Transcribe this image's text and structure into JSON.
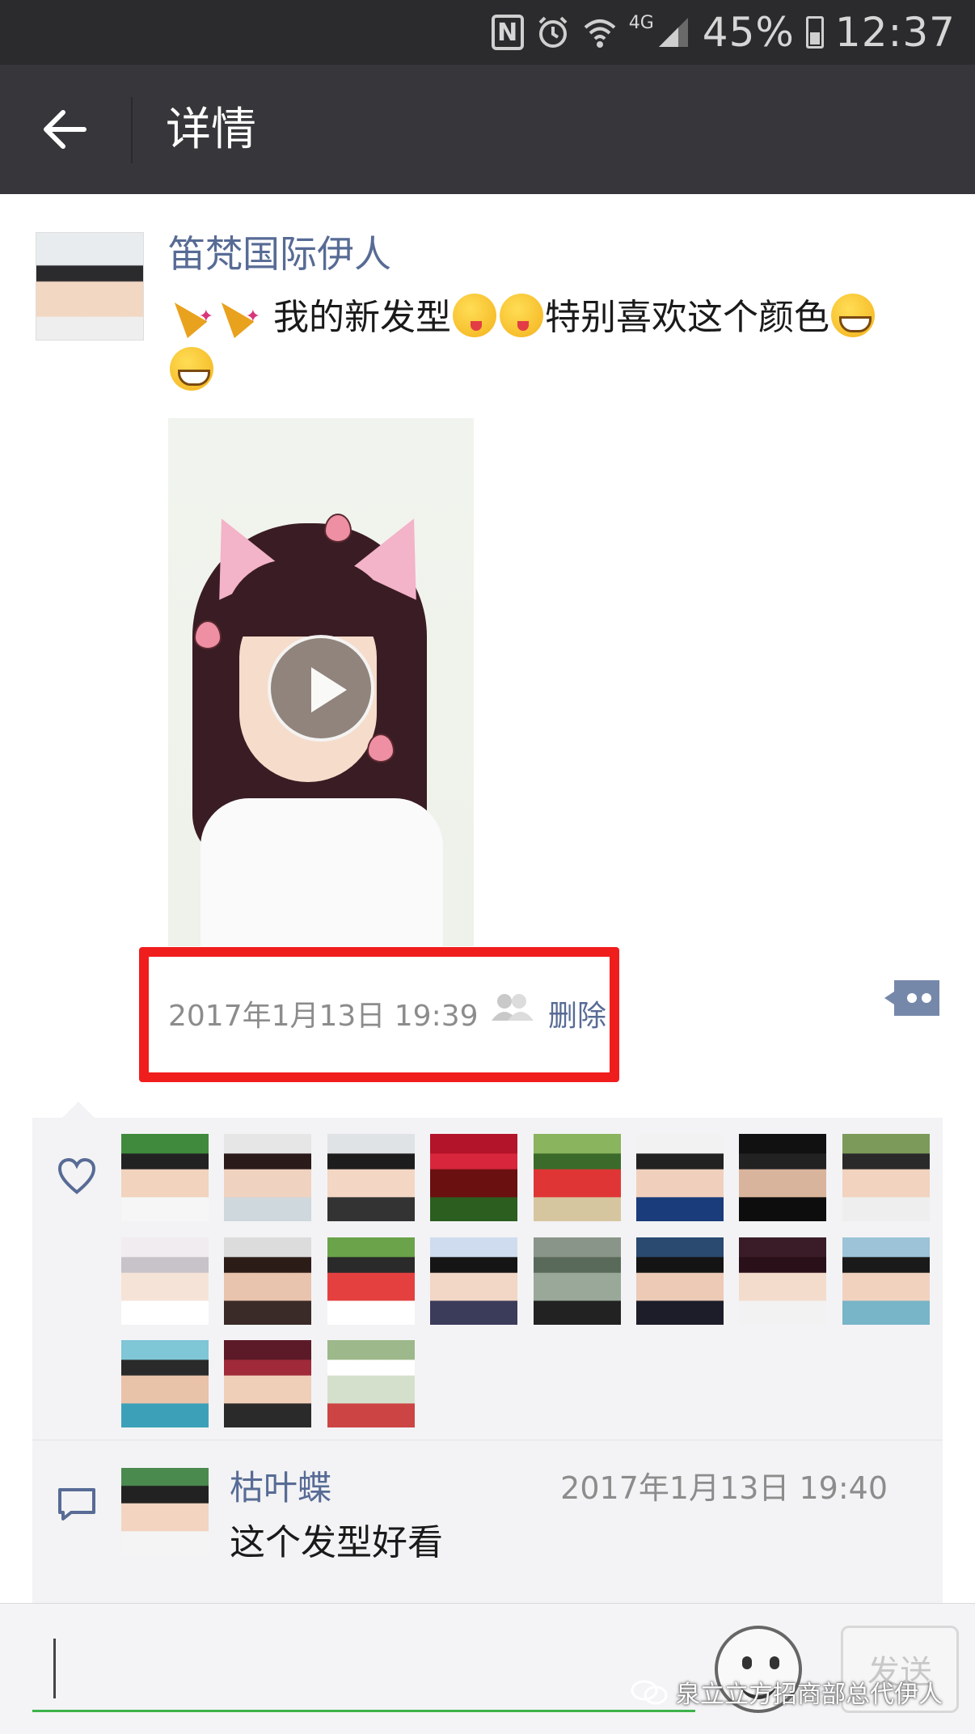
{
  "status_bar": {
    "nfc_label": "N",
    "alarm_icon": "alarm-clock-icon",
    "wifi_icon": "wifi-icon",
    "network_type": "4G",
    "battery_percent": "45%",
    "time": "12:37"
  },
  "title_bar": {
    "back_icon": "arrow-left-icon",
    "title": "详情"
  },
  "post": {
    "author": "笛梵国际伊人",
    "text_parts": [
      "我的新发型",
      "特别喜欢这个颜色"
    ],
    "emoji_icons": [
      "party-popper-icon",
      "party-popper-icon",
      "winking-tongue-face-icon",
      "winking-tongue-face-icon",
      "grinning-face-icon",
      "grinning-face-icon"
    ],
    "media_type": "video",
    "play_icon": "play-icon",
    "timestamp": "2017年1月13日 19:39",
    "visibility_icon": "friends-icon",
    "delete_label": "删除",
    "more_icon": "comment-more-icon"
  },
  "likes": {
    "icon": "heart-outline-icon",
    "count": 19
  },
  "comments": [
    {
      "author": "枯叶蝶",
      "time": "2017年1月13日 19:40",
      "text": "这个发型好看"
    }
  ],
  "comment_icon": "comment-bubble-icon",
  "input_bar": {
    "value": "",
    "emoji_icon": "emoji-face-icon",
    "send_label": "发送"
  },
  "watermark": {
    "icon": "wechat-icon",
    "text": "泉立立方招商部总代伊人"
  },
  "colors": {
    "link_blue": "#576b95",
    "highlight_red": "#f01d1d",
    "input_green": "#3cb34a",
    "titlebar_bg": "#37373b",
    "statusbar_bg": "#2b2b2d"
  }
}
